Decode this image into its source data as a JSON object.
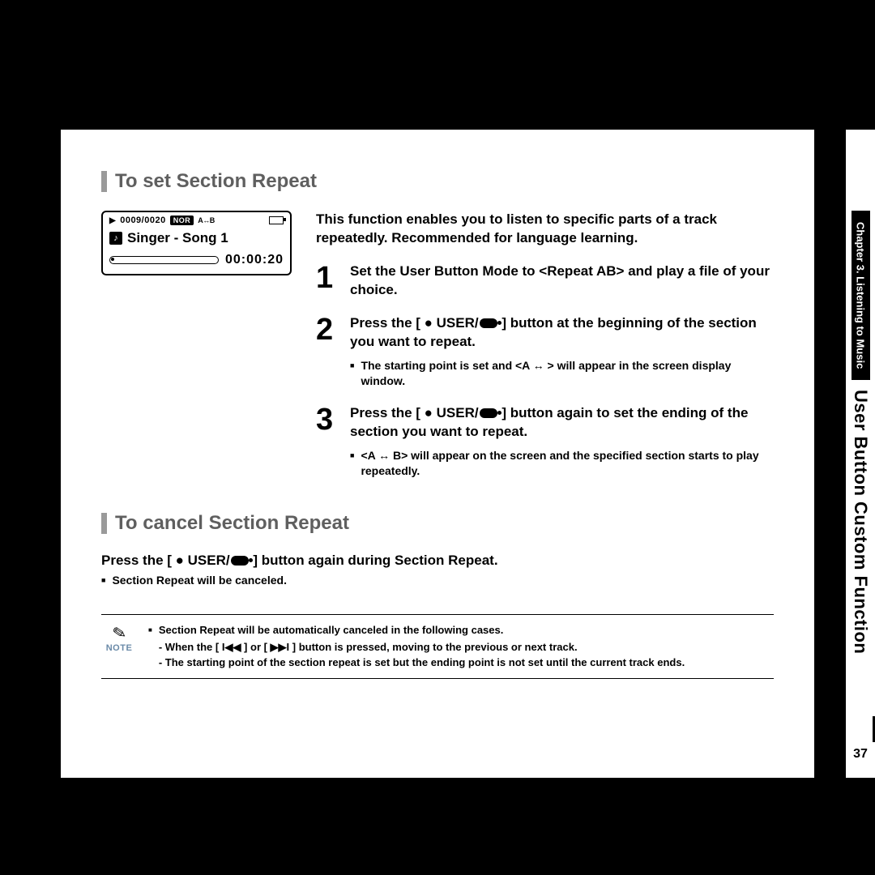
{
  "headings": {
    "set": "To set Section Repeat",
    "cancel": "To cancel Section Repeat"
  },
  "screen": {
    "count": "0009/0020",
    "nor": "NOR",
    "ab": "A↔B",
    "title": "Singer - Song 1",
    "time": "00:00:20"
  },
  "intro": "This function enables you to listen to specific parts of a track repeatedly. Recommended for language learning.",
  "steps": {
    "s1": {
      "num": "1",
      "text": "Set the User Button Mode to <Repeat AB> and play a file of your choice."
    },
    "s2": {
      "num": "2",
      "pre": "Press the [ ● USER/",
      "post": " ] button at the beginning of the section you want to repeat.",
      "sub1": "The starting point is set and <A ↔ > will appear in the screen display window."
    },
    "s3": {
      "num": "3",
      "pre": "Press the [ ● USER/",
      "post": " ] button again to set the ending of the section you want to repeat.",
      "sub1": "<A ↔ B> will appear on the screen and the specified section starts to play repeatedly."
    }
  },
  "cancel": {
    "pre": "Press the [ ● USER/",
    "post": " ] button again during Section Repeat.",
    "sub": "Section Repeat will be canceled."
  },
  "note": {
    "label": "NOTE",
    "lead": "Section Repeat will be automatically canceled in the following cases.",
    "d1": "When the [ I◀◀ ] or [ ▶▶I ] button is pressed, moving to the previous or next track.",
    "d2": "The starting point of the section repeat is set but the ending point is not set until the current track ends."
  },
  "side": {
    "chapter": "Chapter 3. Listening to Music",
    "feature": "User Button Custom Function",
    "page": "37"
  }
}
